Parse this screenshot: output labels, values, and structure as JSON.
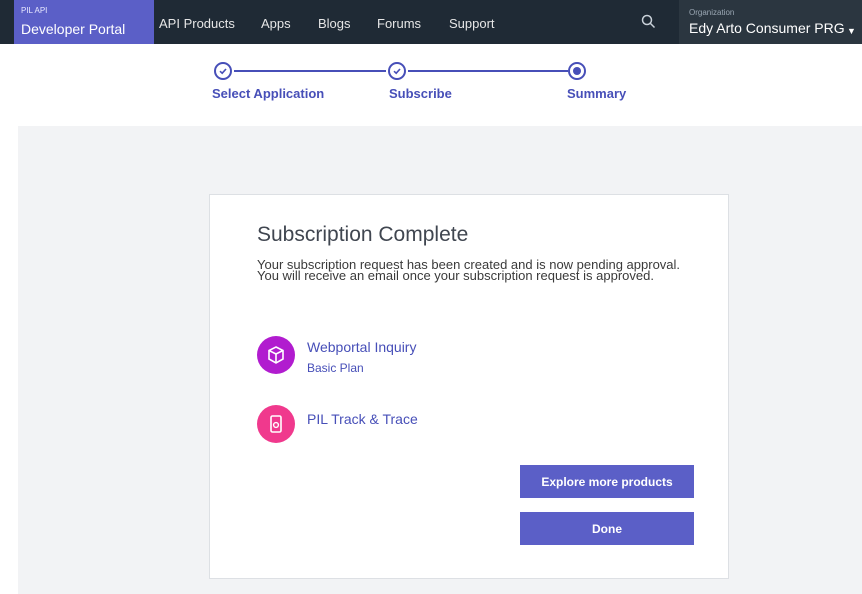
{
  "header": {
    "brand_small": "PIL API",
    "brand_title": "Developer Portal",
    "nav": [
      "API Products",
      "Apps",
      "Blogs",
      "Forums",
      "Support"
    ],
    "search_icon": "search-icon",
    "org_label": "Organization",
    "org_name": "Edy Arto Consumer PRG"
  },
  "stepper": {
    "steps": [
      "Select Application",
      "Subscribe",
      "Summary"
    ],
    "current_step": 3
  },
  "card": {
    "title": "Subscription Complete",
    "message": "Your subscription request has been created and is now pending approval. You will receive an email once your subscription request is approved.",
    "products": [
      {
        "name": "Webportal Inquiry",
        "plan": "Basic Plan",
        "icon": "cube-icon",
        "color": "#b11ccf"
      },
      {
        "name": "PIL Track & Trace",
        "plan": "",
        "icon": "mobile-icon",
        "color": "#f0398d"
      }
    ],
    "explore_button": "Explore more products",
    "done_button": "Done"
  },
  "colors": {
    "accent": "#474fb8",
    "button": "#5b5fc7",
    "topbar": "#1f2a35",
    "background": "#f2f3f5"
  }
}
